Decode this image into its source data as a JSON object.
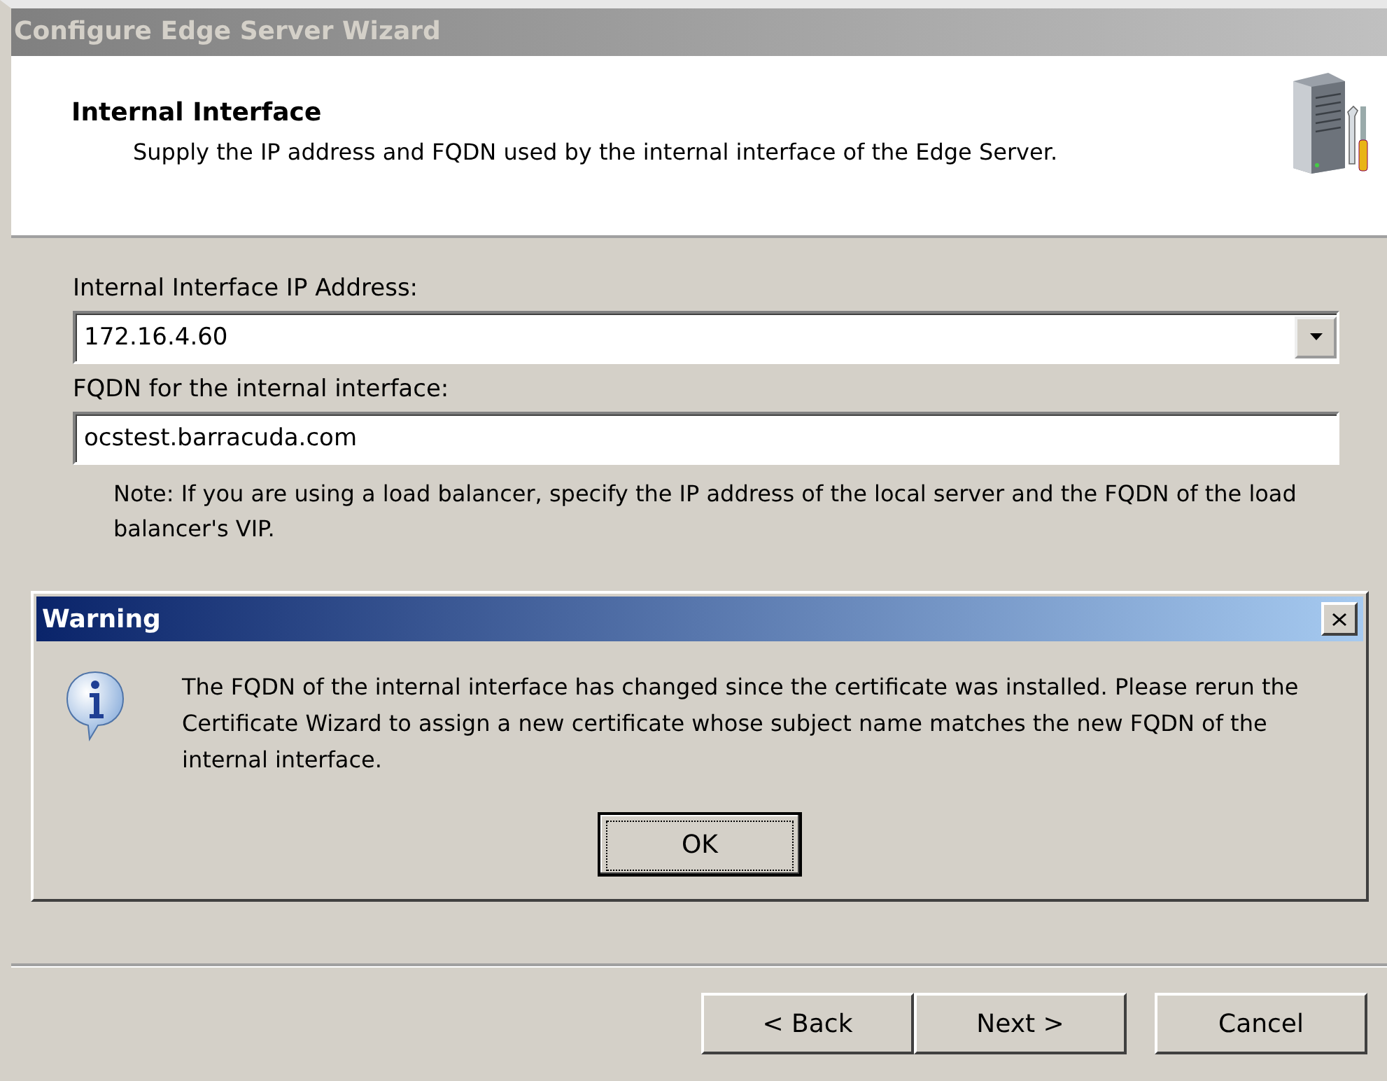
{
  "window": {
    "title": "Configure Edge Server Wizard",
    "active": false
  },
  "header": {
    "title": "Internal Interface",
    "description": "Supply the IP address and FQDN used by the internal interface of the Edge Server."
  },
  "fields": [
    {
      "kind": "dropdown",
      "label": "Internal Interface IP Address:",
      "value": "172.16.4.60"
    },
    {
      "kind": "text",
      "label": "FQDN for the internal interface:",
      "value": "ocstest.barracuda.com"
    }
  ],
  "note": "Note: If you are using a load balancer, specify the IP address of the local server and the FQDN of the load balancer's VIP.",
  "dialog": {
    "title": "Warning",
    "message": "The FQDN of the internal interface has changed since the certificate was installed. Please rerun the Certificate Wizard to assign a new certificate whose subject name matches the new FQDN of the internal interface.",
    "button": "OK"
  },
  "buttons": [
    {
      "label": "< Back",
      "kind": "back"
    },
    {
      "label": "Next >",
      "kind": "next"
    },
    {
      "label": "Cancel",
      "kind": "cancel"
    }
  ]
}
